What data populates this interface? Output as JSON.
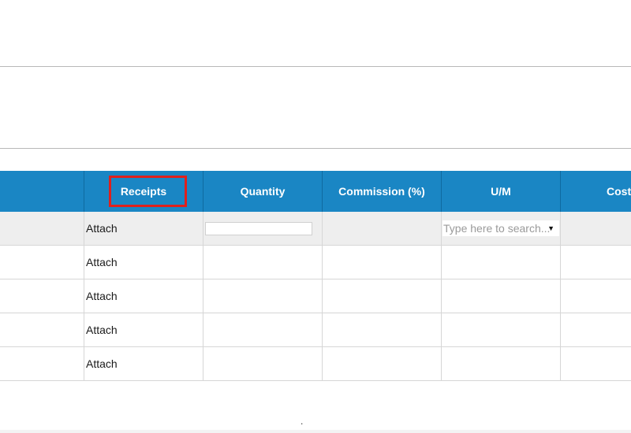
{
  "table": {
    "headers": [
      "",
      "Receipts",
      "Quantity",
      "Commission (%)",
      "U/M",
      "Cost"
    ],
    "highlighted_header": "Receipts",
    "filter_row": {
      "quantity_value": "",
      "um_placeholder": "Type here to search..."
    },
    "rows": [
      {
        "receipts": "Attach"
      },
      {
        "receipts": "Attach"
      },
      {
        "receipts": "Attach"
      },
      {
        "receipts": "Attach"
      },
      {
        "receipts": "Attach"
      }
    ]
  },
  "footer": {
    "dot": "."
  },
  "colors": {
    "header_bg": "#1a86c4",
    "highlight_border": "#e0201c",
    "filter_row_bg": "#eeeeee"
  }
}
